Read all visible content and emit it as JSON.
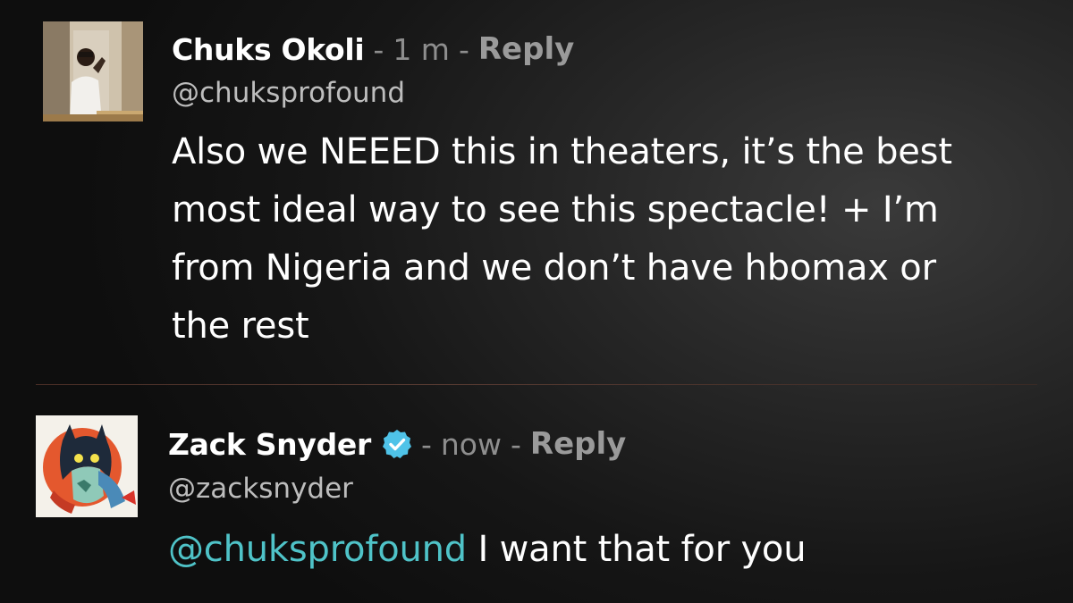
{
  "comments": [
    {
      "author": "Chuks Okoli",
      "time": "1 m",
      "separator": "-",
      "reply_label": "Reply",
      "handle": "@chuksprofound",
      "body": "Also we NEEED this in theaters, it’s the best most ideal way to see this spectacle! + I’m from Nigeria and we don’t have hbomax or the rest",
      "avatar": "profile-photo"
    },
    {
      "author": "Zack Snyder",
      "verified": true,
      "time": "now",
      "separator": "-",
      "reply_label": "Reply",
      "handle": "@zacksnyder",
      "mention": "@chuksprofound",
      "body": "I want that for you",
      "avatar": "comic-art-avatar"
    }
  ],
  "colors": {
    "mention": "#4fc3c8",
    "verified_badge": "#4fc3e8",
    "meta_gray": "#8e8e8e"
  }
}
